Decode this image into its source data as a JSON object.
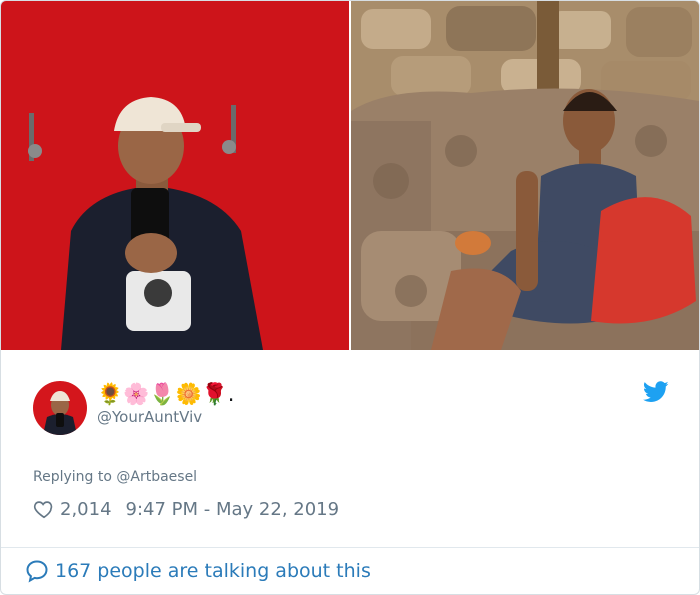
{
  "tweet": {
    "display_name": "🌻🌸🌷🌼🌹.",
    "handle": "@YourAuntViv",
    "replying_to": "Replying to @Artbaesel",
    "likes": "2,014",
    "timestamp": "9:47 PM - May 22, 2019",
    "talking": "167 people are talking about this"
  },
  "icons": {
    "brand": "twitter-bird-icon",
    "like": "heart-icon",
    "conversation": "speech-bubble-icon"
  },
  "colors": {
    "twitter_blue": "#1da1f2",
    "link_blue": "#2b7bb9",
    "muted_text": "#657786",
    "left_photo_wall": "#d4161c"
  }
}
